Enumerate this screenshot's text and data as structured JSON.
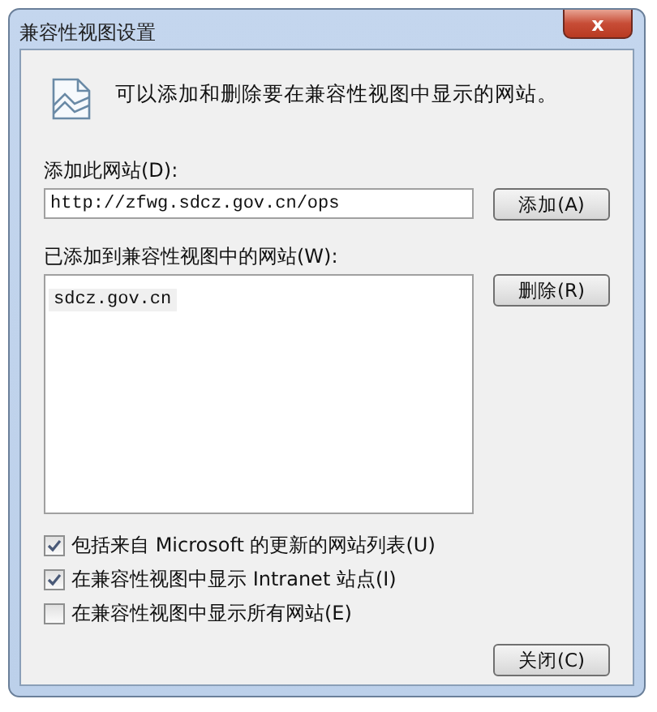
{
  "window": {
    "title": "兼容性视图设置",
    "close_label": "x"
  },
  "intro": "可以添加和删除要在兼容性视图中显示的网站。",
  "add_site": {
    "label": "添加此网站(D):",
    "value": "http://zfwg.sdcz.gov.cn/ops",
    "button": "添加(A)"
  },
  "site_list": {
    "label": "已添加到兼容性视图中的网站(W):",
    "items": [
      {
        "text": "sdcz.gov.cn",
        "selected": true
      }
    ],
    "button": "删除(R)"
  },
  "options": [
    {
      "label": "包括来自 Microsoft 的更新的网站列表(U)",
      "checked": true
    },
    {
      "label": "在兼容性视图中显示 Intranet 站点(I)",
      "checked": true
    },
    {
      "label": "在兼容性视图中显示所有网站(E)",
      "checked": false
    }
  ],
  "close_button": "关闭(C)"
}
